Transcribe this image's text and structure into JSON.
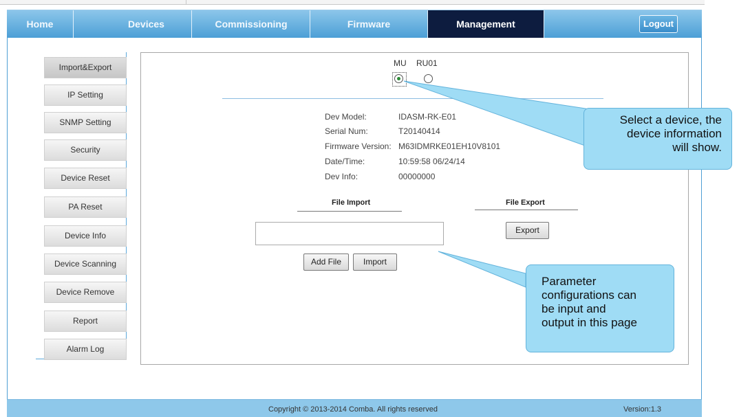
{
  "nav": {
    "home": "Home",
    "devices": "Devices",
    "commissioning": "Commissioning",
    "firmware": "Firmware",
    "management": "Management",
    "logout": "Logout"
  },
  "sidebar": {
    "items": [
      {
        "label": "Import&Export"
      },
      {
        "label": "IP Setting"
      },
      {
        "label": "SNMP Setting"
      },
      {
        "label": "Security"
      },
      {
        "label": "Device Reset"
      },
      {
        "label": "PA Reset"
      },
      {
        "label": "Device Info"
      },
      {
        "label": "Device Scanning"
      },
      {
        "label": "Device Remove"
      },
      {
        "label": "Report"
      },
      {
        "label": "Alarm Log"
      }
    ]
  },
  "device_select": {
    "options": [
      {
        "label": "MU",
        "checked": true
      },
      {
        "label": "RU01",
        "checked": false
      }
    ]
  },
  "device_info": {
    "model_label": "Dev Model:",
    "model_value": "IDASM-RK-E01",
    "serial_label": "Serial Num:",
    "serial_value": "T20140414",
    "firmware_label": "Firmware Version:",
    "firmware_value": "M63IDMRKE01EH10V8101",
    "datetime_label": "Date/Time:",
    "datetime_value": "10:59:58 06/24/14",
    "devinfo_label": "Dev Info:",
    "devinfo_value": "00000000"
  },
  "file_import": {
    "title": "File Import",
    "path_value": "",
    "add_file_label": "Add File",
    "import_label": "Import"
  },
  "file_export": {
    "title": "File Export",
    "export_label": "Export"
  },
  "callouts": {
    "select_device": [
      "Select a device, the",
      "device information",
      "will show."
    ],
    "parameters": [
      "Parameter",
      "configurations can",
      "be input and",
      "output in this page"
    ]
  },
  "footer": {
    "copyright": "Copyright © 2013-2014 Comba. All rights reserved",
    "version": "Version:1.3"
  },
  "colors": {
    "nav_active": "#0d1c3f",
    "nav_bar": "#5aaade",
    "callout_fill": "#9fdcf5",
    "radio_checked": "#2c8a36"
  }
}
